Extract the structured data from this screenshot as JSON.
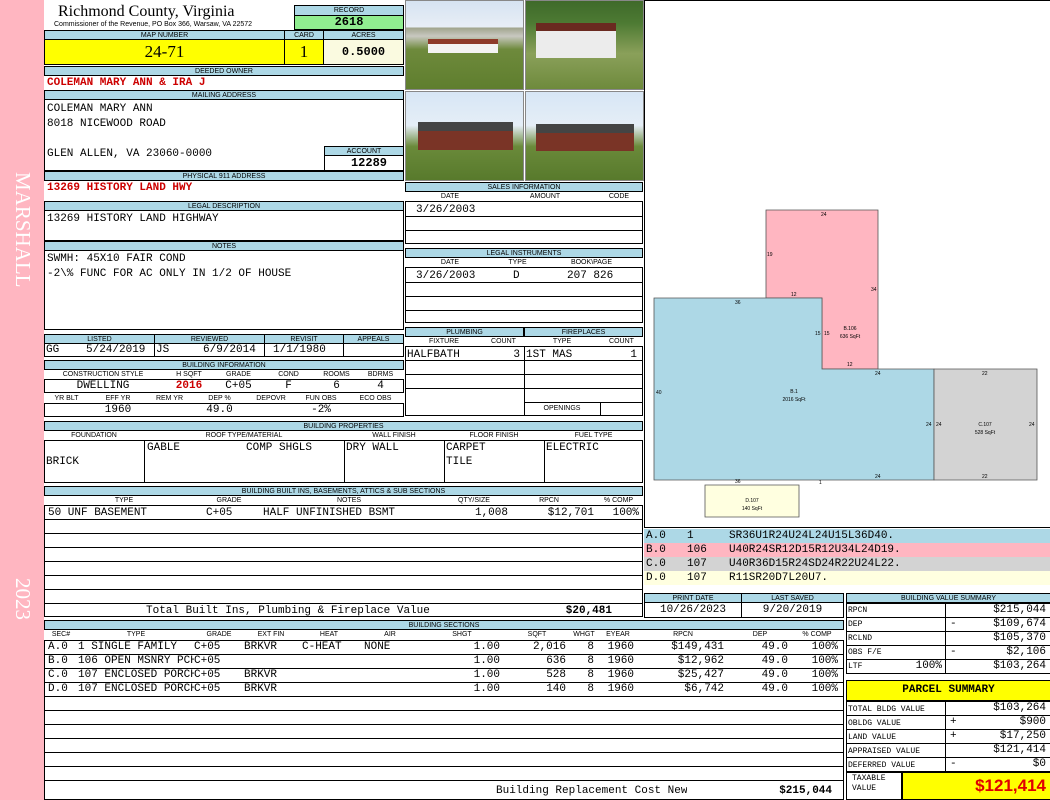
{
  "sidebar": {
    "district": "MARSHALL",
    "year": "2023"
  },
  "header": {
    "county": "Richmond County, Virginia",
    "commissioner": "Commissioner of the Revenue, PO Box 366, Warsaw, VA 22572",
    "record_label": "RECORD",
    "record": "2618"
  },
  "parcel": {
    "map_label": "MAP NUMBER",
    "map": "24-71",
    "card_label": "CARD",
    "card": "1",
    "acres_label": "ACRES",
    "acres": "0.5000"
  },
  "owner": {
    "deeded_label": "DEEDED OWNER",
    "deeded": "COLEMAN MARY ANN & IRA J",
    "mailing_label": "MAILING ADDRESS",
    "line1": "COLEMAN MARY ANN",
    "line2": "8018 NICEWOOD ROAD",
    "line3": "GLEN ALLEN, VA 23060-0000",
    "account_label": "ACCOUNT",
    "account": "12289"
  },
  "physical": {
    "label": "PHYSICAL 911 ADDRESS",
    "value": "13269 HISTORY LAND HWY"
  },
  "legal": {
    "label": "LEGAL DESCRIPTION",
    "value": "13269 HISTORY LAND HIGHWAY"
  },
  "notes": {
    "label": "NOTES",
    "line1": "SWMH: 45X10 FAIR COND",
    "line2": "-2\\% FUNC FOR AC ONLY IN 1/2 OF HOUSE"
  },
  "review": {
    "listed_label": "LISTED",
    "reviewed_label": "REVIEWED",
    "revisit_label": "REVISIT",
    "appeals_label": "APPEALS",
    "listed_by": "GG",
    "listed_date": "5/24/2019",
    "reviewed_by": "JS",
    "reviewed_date": "6/9/2014",
    "revisit": "1/1/1980"
  },
  "bldginfo": {
    "label": "BUILDING INFORMATION",
    "h": [
      "CONSTRUCTION STYLE",
      "H SQFT",
      "GRADE",
      "COND",
      "ROOMS",
      "BDRMS"
    ],
    "style": "DWELLING",
    "hsqft": "2016",
    "grade": "C+05",
    "cond": "F",
    "rooms": "6",
    "bdrms": "4",
    "h2": [
      "YR BLT",
      "EFF YR",
      "REM YR",
      "DEP %",
      "DEPOVR",
      "FUN OBS",
      "ECO OBS"
    ],
    "effyr": "1960",
    "dep": "49.0",
    "funobs": "-2%"
  },
  "sales": {
    "label": "SALES INFORMATION",
    "h": [
      "DATE",
      "AMOUNT",
      "CODE"
    ],
    "date": "3/26/2003"
  },
  "legalinst": {
    "label": "LEGAL INSTRUMENTS",
    "h": [
      "DATE",
      "TYPE",
      "BOOK\\PAGE"
    ],
    "date": "3/26/2003",
    "type": "D",
    "book": "207 826"
  },
  "plumbing": {
    "label": "PLUMBING",
    "h": [
      "FIXTURE",
      "COUNT"
    ],
    "fixture": "HALFBATH",
    "count": "3"
  },
  "fireplaces": {
    "label": "FIREPLACES",
    "h": [
      "TYPE",
      "COUNT"
    ],
    "type": "1ST MAS",
    "count": "1",
    "openings": "OPENINGS"
  },
  "props": {
    "label": "BUILDING PROPERTIES",
    "h": [
      "FOUNDATION",
      "ROOF TYPE/MATERIAL",
      "WALL FINISH",
      "FLOOR FINISH",
      "FUEL TYPE"
    ],
    "foundation": "BRICK",
    "roof1": "GABLE",
    "roof2": "COMP SHGLS",
    "wall": "DRY WALL",
    "floor1": "CARPET",
    "floor2": "TILE",
    "fuel": "ELECTRIC"
  },
  "builtins": {
    "label": "BUILDING BUILT INS, BASEMENTS, ATTICS & SUB SECTIONS",
    "h": [
      "TYPE",
      "GRADE",
      "NOTES",
      "QTY/SIZE",
      "RPCN",
      "% COMP"
    ],
    "row": {
      "type": "50 UNF BASEMENT",
      "grade": "C+05",
      "notes": "HALF UNFINISHED BSMT",
      "qty": "1,008",
      "rpcn": "$12,701",
      "comp": "100%"
    },
    "total_label": "Total Built Ins, Plumbing & Fireplace Value",
    "total": "$20,481"
  },
  "sections": {
    "label": "BUILDING SECTIONS",
    "h": [
      "SEC#",
      "TYPE",
      "GRADE",
      "EXT FIN",
      "HEAT",
      "AIR",
      "SHGT",
      "SQFT",
      "WHGT",
      "EYEAR",
      "RPCN",
      "DEP",
      "% COMP"
    ],
    "rows": [
      {
        "sec": "A.0",
        "type": "1 SINGLE FAMILY",
        "grade": "C+05",
        "ext": "BRKVR",
        "heat": "C-HEAT",
        "air": "NONE",
        "shgt": "1.00",
        "sqft": "2,016",
        "whgt": "8",
        "eyear": "1960",
        "rpcn": "$149,431",
        "dep": "49.0",
        "comp": "100%"
      },
      {
        "sec": "B.0",
        "type": "106 OPEN MSNRY PCH",
        "grade": "C+05",
        "ext": "",
        "heat": "",
        "air": "",
        "shgt": "1.00",
        "sqft": "636",
        "whgt": "8",
        "eyear": "1960",
        "rpcn": "$12,962",
        "dep": "49.0",
        "comp": "100%"
      },
      {
        "sec": "C.0",
        "type": "107 ENCLOSED PORCH",
        "grade": "C+05",
        "ext": "BRKVR",
        "heat": "",
        "air": "",
        "shgt": "1.00",
        "sqft": "528",
        "whgt": "8",
        "eyear": "1960",
        "rpcn": "$25,427",
        "dep": "49.0",
        "comp": "100%"
      },
      {
        "sec": "D.0",
        "type": "107 ENCLOSED PORCH",
        "grade": "C+05",
        "ext": "BRKVR",
        "heat": "",
        "air": "",
        "shgt": "1.00",
        "sqft": "140",
        "whgt": "8",
        "eyear": "1960",
        "rpcn": "$6,742",
        "dep": "49.0",
        "comp": "100%"
      }
    ],
    "brcn_label": "Building Replacement Cost New",
    "brcn": "$215,044"
  },
  "sketch": {
    "a_label": "B.1",
    "a_area": "2016 SqFt",
    "b_label": "B.106",
    "b_area": "636 SqFt",
    "c_label": "C.107",
    "c_area": "528 SqFt",
    "d_label": "D.107",
    "d_area": "140 SqFt",
    "dims": {
      "b_top": "24",
      "b_left": "19",
      "b_right": "34",
      "b_inner": "12",
      "b_15a": "15",
      "b_15b": "15",
      "b_12": "12",
      "a_top": "36",
      "a_left": "40",
      "a_bot": "36",
      "a_24r": "24",
      "a_24b": "24",
      "a_1": "1",
      "c_top": "22",
      "c_bot": "22",
      "c_left": "24",
      "c_right": "24",
      "c_24": "24"
    },
    "colors": {
      "a": "#add8e6",
      "b": "#ffb6c1",
      "c": "#d3d3d3",
      "d": "#ffffe0"
    }
  },
  "vectors": [
    {
      "sec": "A.0",
      "num": "1",
      "code": "SR36U1R24U24L24U15L36D40.",
      "color": "#add8e6"
    },
    {
      "sec": "B.0",
      "num": "106",
      "code": "U40R24SR12D15R12U34L24D19.",
      "color": "#ffb6c1"
    },
    {
      "sec": "C.0",
      "num": "107",
      "code": "U40R36D15R24SD24R22U24L22.",
      "color": "#d3d3d3"
    },
    {
      "sec": "D.0",
      "num": "107",
      "code": "R11SR20D7L20U7.",
      "color": "#ffffe0"
    }
  ],
  "dates": {
    "print_label": "PRINT DATE",
    "print": "10/26/2023",
    "saved_label": "LAST SAVED",
    "saved": "9/20/2019"
  },
  "bvs": {
    "label": "BUILDING VALUE SUMMARY",
    "rows": [
      {
        "k": "RPCN",
        "s": "",
        "v": "$215,044"
      },
      {
        "k": "DEP",
        "s": "-",
        "v": "$109,674"
      },
      {
        "k": "RCLND",
        "s": "",
        "v": "$105,370"
      },
      {
        "k": "OBS F/E",
        "s": "-",
        "v": "$2,106"
      },
      {
        "k": "LTF",
        "p": "100%",
        "s": "",
        "v": "$103,264"
      }
    ]
  },
  "summary": {
    "label": "PARCEL SUMMARY",
    "rows": [
      {
        "k": "TOTAL BLDG VALUE",
        "s": "",
        "v": "$103,264"
      },
      {
        "k": "OBLDG VALUE",
        "s": "+",
        "v": "$900"
      },
      {
        "k": "LAND VALUE",
        "s": "+",
        "v": "$17,250"
      },
      {
        "k": "APPRAISED VALUE",
        "s": "",
        "v": "$121,414"
      },
      {
        "k": "DEFERRED VALUE",
        "s": "-",
        "v": "$0"
      }
    ],
    "taxable_label": "TAXABLE VALUE",
    "taxable": "$121,414"
  }
}
